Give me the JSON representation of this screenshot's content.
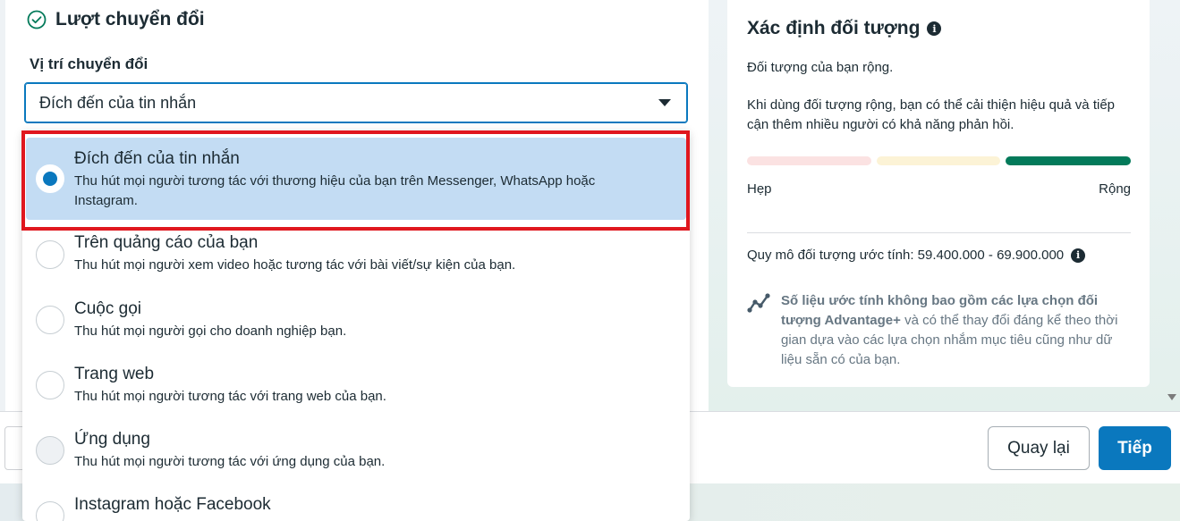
{
  "section": {
    "title": "Lượt chuyển đổi"
  },
  "conversion_location": {
    "label": "Vị trí chuyển đổi",
    "selected_value": "Đích đến của tin nhắn",
    "options": [
      {
        "title": "Đích đến của tin nhắn",
        "desc": "Thu hút mọi người tương tác với thương hiệu của bạn trên Messenger, WhatsApp hoặc Instagram."
      },
      {
        "title": "Trên quảng cáo của bạn",
        "desc": "Thu hút mọi người xem video hoặc tương tác với bài viết/sự kiện của bạn."
      },
      {
        "title": "Cuộc gọi",
        "desc": "Thu hút mọi người gọi cho doanh nghiệp bạn."
      },
      {
        "title": "Trang web",
        "desc": "Thu hút mọi người tương tác với trang web của bạn."
      },
      {
        "title": "Ứng dụng",
        "desc": "Thu hút mọi người tương tác với ứng dụng của bạn."
      },
      {
        "title": "Instagram hoặc Facebook",
        "desc": ""
      }
    ]
  },
  "audience": {
    "title": "Xác định đối tượng",
    "status": "Đối tượng của bạn rộng.",
    "advice": "Khi dùng đối tượng rộng, bạn có thể cải thiện hiệu quả và tiếp cận thêm nhiều người có khả năng phản hồi.",
    "meter_low": "Hẹp",
    "meter_high": "Rộng",
    "meter_level": "broad",
    "size_label": "Quy mô đối tượng ước tính: 59.400.000 - 69.900.000",
    "note_prefix": "Số liệu ước tính không bao gồm các lựa chọn đối tượng Advantage+",
    "note_suffix": " và có thể thay đổi đáng kể theo thời gian dựa vào các lựa chọn nhắm mục tiêu cũng như dữ liệu sẵn có của bạn."
  },
  "footer": {
    "back_label": "Quay lại",
    "next_label": "Tiếp"
  },
  "colors": {
    "accent": "#0a78be",
    "selected_bg": "#c3dcf3",
    "highlight_red": "#e0171e",
    "meter_narrow": "#fbe2e2",
    "meter_mid": "#fcf3d6",
    "meter_broad": "#037a5a"
  }
}
